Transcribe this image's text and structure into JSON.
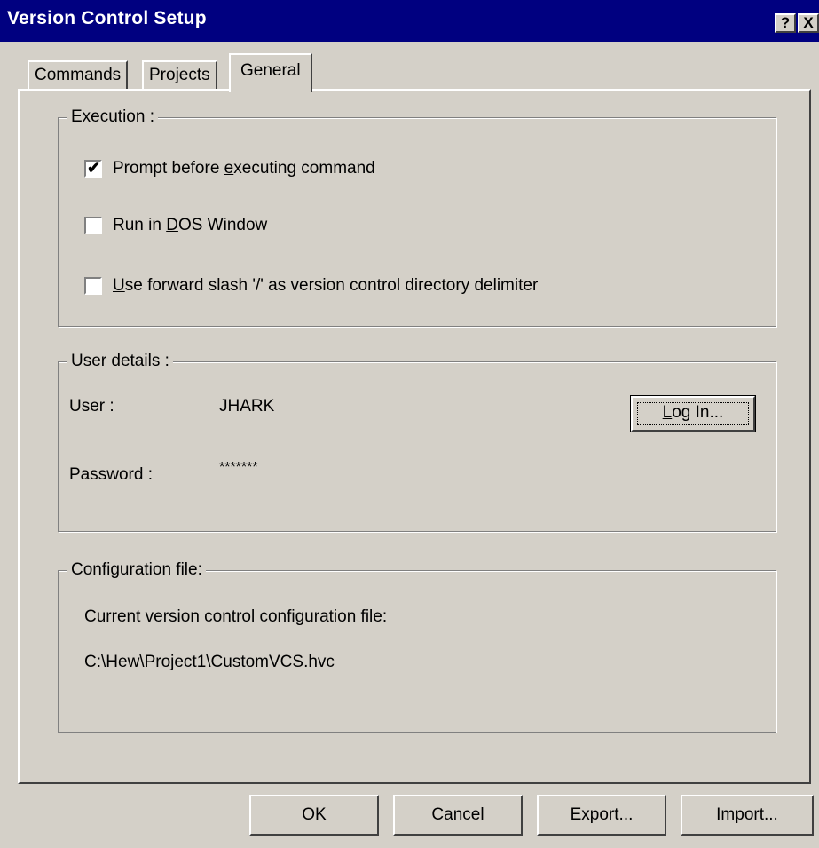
{
  "window": {
    "title": "Version Control Setup",
    "help_glyph": "?",
    "close_glyph": "X"
  },
  "tabs": [
    {
      "label": "Commands",
      "active": false
    },
    {
      "label": "Projects",
      "active": false
    },
    {
      "label": "General",
      "active": true
    }
  ],
  "execution": {
    "group_label": "Execution :",
    "options": [
      {
        "label_pre": "Prompt before ",
        "label_u": "e",
        "label_post": "xecuting command",
        "checked": true
      },
      {
        "label_pre": "Run in ",
        "label_u": "D",
        "label_post": "OS Window",
        "checked": false
      },
      {
        "label_pre": "",
        "label_u": "U",
        "label_post": "se forward slash '/' as version control directory delimiter",
        "checked": false
      }
    ],
    "check_glyph": "✔"
  },
  "user_details": {
    "group_label": "User details :",
    "user_label": "User :",
    "user_value": "JHARK",
    "password_label": "Password :",
    "password_value": "*******",
    "login_button": {
      "u": "L",
      "rest": "og In..."
    }
  },
  "config_file": {
    "group_label": "Configuration file:",
    "description": "Current version control configuration file:",
    "path": "C:\\Hew\\Project1\\CustomVCS.hvc"
  },
  "buttons": {
    "ok": "OK",
    "cancel": "Cancel",
    "export": "Export...",
    "import": "Import..."
  }
}
